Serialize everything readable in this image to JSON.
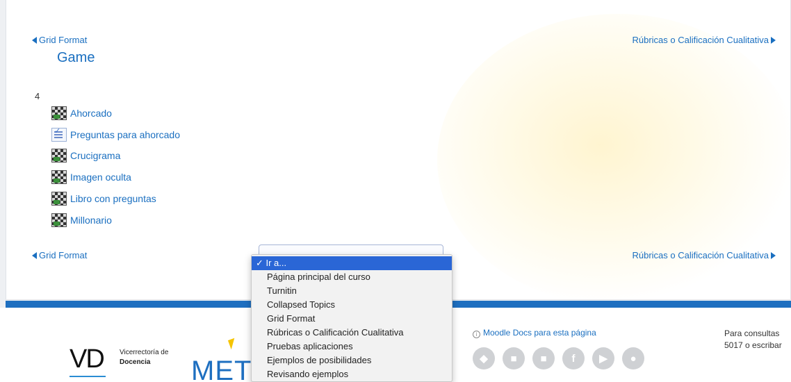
{
  "nav": {
    "prev_label": "Grid Format",
    "next_label": "Rúbricas o Calificación Cualitativa"
  },
  "section": {
    "title": "Game",
    "number": "4"
  },
  "activities": [
    {
      "label": "Ahorcado",
      "icon": "game-icon"
    },
    {
      "label": "Preguntas para ahorcado",
      "icon": "quiz-icon"
    },
    {
      "label": "Crucigrama",
      "icon": "game-icon"
    },
    {
      "label": "Imagen oculta",
      "icon": "game-icon"
    },
    {
      "label": "Libro con preguntas",
      "icon": "game-icon"
    },
    {
      "label": "Millonario",
      "icon": "game-icon"
    }
  ],
  "jump_menu": {
    "selected": "✓ Ir a...",
    "options": [
      "Página principal del curso",
      "Turnitin",
      "Collapsed Topics",
      "Grid Format",
      "Rúbricas o Calificación Cualitativa",
      "Pruebas aplicaciones",
      "Ejemplos de posibilidades",
      "Revisando ejemplos"
    ]
  },
  "footer": {
    "vd_logo": "VD",
    "vd_line1": "Vicerrectoría de",
    "vd_line2": "Docencia",
    "metic_logo": "METI",
    "docs_link": "Moodle Docs para esta página",
    "contact_line1": "Para consultas",
    "contact_line2": "5017 o escribar",
    "social_icons": [
      "android-icon",
      "apple-icon",
      "windows-icon",
      "facebook-icon",
      "youtube-icon",
      "web-icon"
    ]
  },
  "colors": {
    "link": "#1a6fc0",
    "footer_bar": "#1e6fc0",
    "selected_option": "#2a66d6"
  }
}
